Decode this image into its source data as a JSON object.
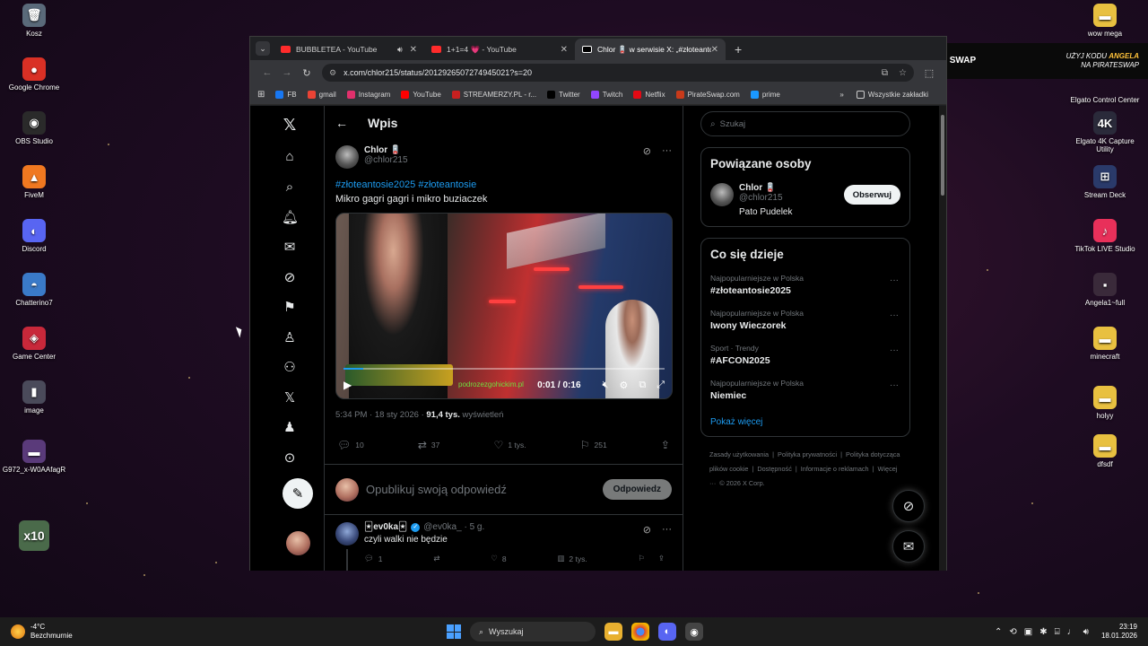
{
  "desktop_left": [
    {
      "label": "Kosz",
      "icon": "recycle-bin-icon",
      "color": "#5a6a7a",
      "glyph": "🗑"
    },
    {
      "label": "Google Chrome",
      "icon": "chrome-icon",
      "color": "#d93025",
      "glyph": "●"
    },
    {
      "label": "OBS Studio",
      "icon": "obs-icon",
      "color": "#2a2a2a",
      "glyph": "◉"
    },
    {
      "label": "FiveM",
      "icon": "fivem-icon",
      "color": "#f07820",
      "glyph": "▲"
    },
    {
      "label": "Discord",
      "icon": "discord-icon",
      "color": "#5865f2",
      "glyph": "◐"
    },
    {
      "label": "Chatterino7",
      "icon": "chatterino-icon",
      "color": "#3a7ac8",
      "glyph": "◓"
    },
    {
      "label": "Game Center",
      "icon": "game-center-icon",
      "color": "#c8283a",
      "glyph": "◈"
    },
    {
      "label": "image",
      "icon": "image-file-icon",
      "color": "#4a4a5a",
      "glyph": "▮"
    },
    {
      "label": "G972_x-W0AAfagR",
      "icon": "image-file-icon-2",
      "color": "#5a3a7a",
      "glyph": "▬"
    },
    {
      "label": "",
      "icon": "frog-x10-icon",
      "color": "#4a6a4a",
      "glyph": "x10"
    }
  ],
  "desktop_right": [
    {
      "label": "wow mega",
      "icon": "folder-icon",
      "color": "#e8c040",
      "glyph": "▬"
    },
    {
      "label": "Elgato Control Center",
      "icon": "elgato-control-icon",
      "color": "#2a2a3a",
      "glyph": "◇"
    },
    {
      "label": "Elgato 4K Capture Utility",
      "icon": "elgato-capture-icon",
      "color": "#2a2a3a",
      "glyph": "4K"
    },
    {
      "label": "Stream Deck",
      "icon": "stream-deck-icon",
      "color": "#2a3a6a",
      "glyph": "⊞"
    },
    {
      "label": "TikTok LIVE Studio",
      "icon": "tiktok-icon",
      "color": "#e8305a",
      "glyph": "♪"
    },
    {
      "label": "Angela1~full",
      "icon": "image-file-icon-3",
      "color": "#3a2a3a",
      "glyph": "▪"
    },
    {
      "label": "minecraft",
      "icon": "folder-minecraft-icon",
      "color": "#e8c040",
      "glyph": "▬"
    },
    {
      "label": "holyy",
      "icon": "folder-holyy-icon",
      "color": "#e8c040",
      "glyph": "▬"
    },
    {
      "label": "dfsdf",
      "icon": "folder-dfsdf-icon",
      "color": "#e8c040",
      "glyph": "▬"
    }
  ],
  "browser": {
    "tabs": [
      {
        "title": "BUBBLETEA - YouTube",
        "fav_color": "#ff2b2b",
        "audio": true
      },
      {
        "title": "1+1=4 💗 - YouTube",
        "fav_color": "#ff2b2b",
        "audio": false
      },
      {
        "title": "Chlor 🪫 w serwisie X: „#złoteantosie",
        "fav_color": "#000000",
        "audio": false
      }
    ],
    "url": "x.com/chlor215/status/2012926507274945021?s=20",
    "bookmarks": [
      {
        "label": "FB",
        "color": "#1877f2"
      },
      {
        "label": "gmail",
        "color": "#ea4335"
      },
      {
        "label": "Instagram",
        "color": "#e1306c"
      },
      {
        "label": "YouTube",
        "color": "#ff0000"
      },
      {
        "label": "STREAMERZY.PL - r...",
        "color": "#c82020"
      },
      {
        "label": "Twitter",
        "color": "#000000"
      },
      {
        "label": "Twitch",
        "color": "#9146ff"
      },
      {
        "label": "Netflix",
        "color": "#e50914"
      },
      {
        "label": "PirateSwap.com",
        "color": "#c83a1a"
      },
      {
        "label": "prime",
        "color": "#1a98ff"
      }
    ],
    "all_bookmarks": "Wszystkie zakładki",
    "more": "»"
  },
  "x": {
    "header_title": "Wpis",
    "author_name": "Chlor 🪫",
    "author_handle": "@chlor215",
    "hashtag1": "#złoteantosie2025",
    "hashtag2": "#złoteantosie",
    "text": "Mikro gagri gagri i mikro buziaczek",
    "video_time": "0:01 / 0:16",
    "video_progress": 0.0625,
    "video_overlay_text": "podrozezgohickim.pl",
    "timestamp": "5:34 PM · 18 sty 2026 · ",
    "views_count": "91,4 tys.",
    "views_label": " wyświetleń",
    "stats": {
      "replies": "10",
      "reposts": "37",
      "likes": "1 tys.",
      "bookmarks": "251"
    },
    "reply_placeholder": "Opublikuj swoją odpowiedź",
    "reply_button": "Odpowiedz",
    "reply": {
      "name": "🃏ev0ka🃏",
      "handle": "@ev0ka_ · 5 g.",
      "text": "czyli walki nie będzie",
      "replies": "1",
      "likes": "8",
      "views": "2 tys."
    },
    "search_placeholder": "Szukaj",
    "related_title": "Powiązane osoby",
    "related": {
      "name": "Chlor 🪫",
      "handle": "@chlor215",
      "bio": "Pato Pudelek",
      "follow": "Obserwuj"
    },
    "trends_title": "Co się dzieje",
    "trends": [
      {
        "cat": "Najpopularniejsze w Polska",
        "name": "#złoteantosie2025"
      },
      {
        "cat": "Najpopularniejsze w Polska",
        "name": "Iwony Wieczorek"
      },
      {
        "cat": "Sport · Trendy",
        "name": "#AFCON2025"
      },
      {
        "cat": "Najpopularniejsze w Polska",
        "name": "Niemiec"
      }
    ],
    "show_more": "Pokaż więcej",
    "footer": [
      "Zasady użytkowania",
      "|",
      "Polityka prywatności",
      "|",
      "Polityka dotycząca plików cookie",
      "|",
      "Dostępność",
      "|",
      "Informacje o reklamach",
      "|",
      "Więcej ···",
      "© 2026 X Corp."
    ]
  },
  "promo": {
    "brand": "PIRATE SWAP",
    "slogan_pre": "UŻYJ KODU ",
    "code": "ANGELA",
    "slogan_post": "NA PIRATESWAP"
  },
  "taskbar": {
    "temp": "-4°C",
    "weather": "Bezchmurnie",
    "search": "Wyszukaj",
    "time": "23:19",
    "date": "18.01.2026"
  }
}
